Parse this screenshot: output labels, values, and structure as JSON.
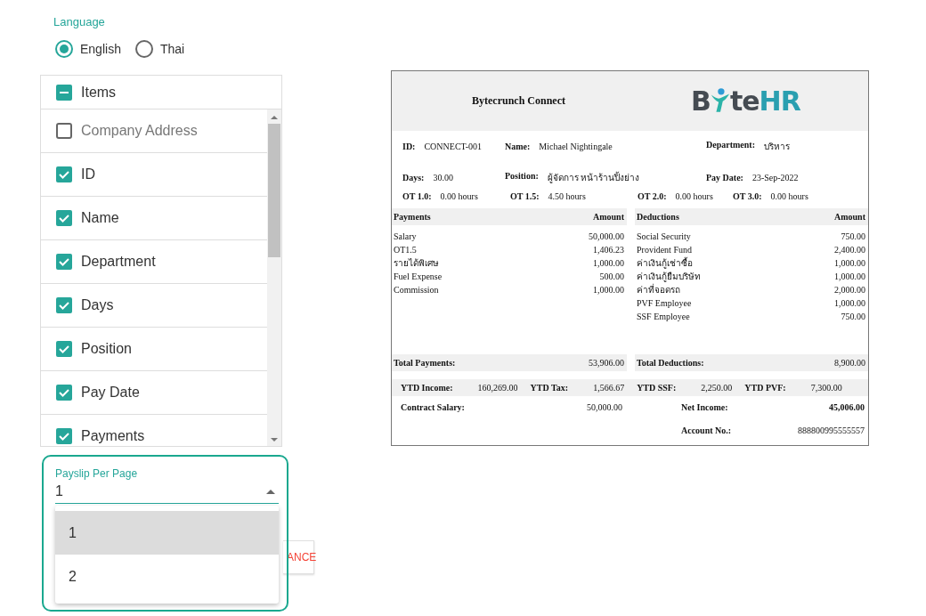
{
  "language": {
    "label": "Language",
    "options": [
      {
        "label": "English",
        "selected": true
      },
      {
        "label": "Thai",
        "selected": false
      }
    ]
  },
  "items": {
    "header": {
      "label": "Items",
      "indeterminate": true
    },
    "rows": [
      {
        "label": "Company Address",
        "checked": false
      },
      {
        "label": "ID",
        "checked": true
      },
      {
        "label": "Name",
        "checked": true
      },
      {
        "label": "Department",
        "checked": true
      },
      {
        "label": "Days",
        "checked": true
      },
      {
        "label": "Position",
        "checked": true
      },
      {
        "label": "Pay Date",
        "checked": true
      },
      {
        "label": "Payments",
        "checked": true
      }
    ]
  },
  "payslip_per_page": {
    "label": "Payslip Per Page",
    "value": "1",
    "options": [
      {
        "label": "1",
        "selected": true
      },
      {
        "label": "2",
        "selected": false
      }
    ]
  },
  "cancel_button": {
    "label": "ANCE"
  },
  "payslip": {
    "company": "Bytecrunch Connect",
    "logo": {
      "prefix": "B",
      "middle": "te",
      "suffix": "HR"
    },
    "info_rows": [
      [
        {
          "label": "ID:",
          "value": "CONNECT-001"
        },
        {
          "label": "Name:",
          "value": "Michael Nightingale"
        },
        {
          "label": "Department:",
          "value": "บริหาร"
        }
      ],
      [
        {
          "label": "Days:",
          "value": "30.00"
        },
        {
          "label": "Position:",
          "value": "ผู้จัดการ หน้าร้านปิ้งย่าง"
        },
        {
          "label": "Pay Date:",
          "value": "23-Sep-2022"
        }
      ]
    ],
    "ot": [
      {
        "label": "OT 1.0:",
        "value": "0.00 hours"
      },
      {
        "label": "OT 1.5:",
        "value": "4.50 hours"
      },
      {
        "label": "OT 2.0:",
        "value": "0.00 hours"
      },
      {
        "label": "OT 3.0:",
        "value": "0.00 hours"
      }
    ],
    "tables": [
      {
        "heading": "Payments",
        "amount_heading": "Amount",
        "rows": [
          {
            "name": "Salary",
            "amount": "50,000.00"
          },
          {
            "name": "OT1.5",
            "amount": "1,406.23"
          },
          {
            "name": "รายได้พิเศษ",
            "amount": "1,000.00"
          },
          {
            "name": "Fuel Expense",
            "amount": "500.00"
          },
          {
            "name": "Commission",
            "amount": "1,000.00"
          }
        ],
        "total_label": "Total Payments:",
        "total": "53,906.00"
      },
      {
        "heading": "Deductions",
        "amount_heading": "Amount",
        "rows": [
          {
            "name": "Social Security",
            "amount": "750.00"
          },
          {
            "name": "Provident Fund",
            "amount": "2,400.00"
          },
          {
            "name": "ค่าเงินกู้เช่าซื้อ",
            "amount": "1,000.00"
          },
          {
            "name": "ค่าเงินกู้ยืมบริษัท",
            "amount": "1,000.00"
          },
          {
            "name": "ค่าที่จอดรถ",
            "amount": "2,000.00"
          },
          {
            "name": "PVF Employee",
            "amount": "1,000.00"
          },
          {
            "name": "SSF Employee",
            "amount": "750.00"
          }
        ],
        "total_label": "Total Deductions:",
        "total": "8,900.00"
      }
    ],
    "ytd": [
      {
        "label": "YTD Income:",
        "value": "160,269.00"
      },
      {
        "label": "YTD Tax:",
        "value": "1,566.67"
      },
      {
        "label": "YTD SSF:",
        "value": "2,250.00"
      },
      {
        "label": "YTD PVF:",
        "value": "7,300.00"
      }
    ],
    "contract_salary": {
      "label": "Contract Salary:",
      "value": "50,000.00"
    },
    "net_income": {
      "label": "Net Income:",
      "value": "45,006.00"
    },
    "account_no": {
      "label": "Account No.:",
      "value": "888800995555557"
    }
  }
}
